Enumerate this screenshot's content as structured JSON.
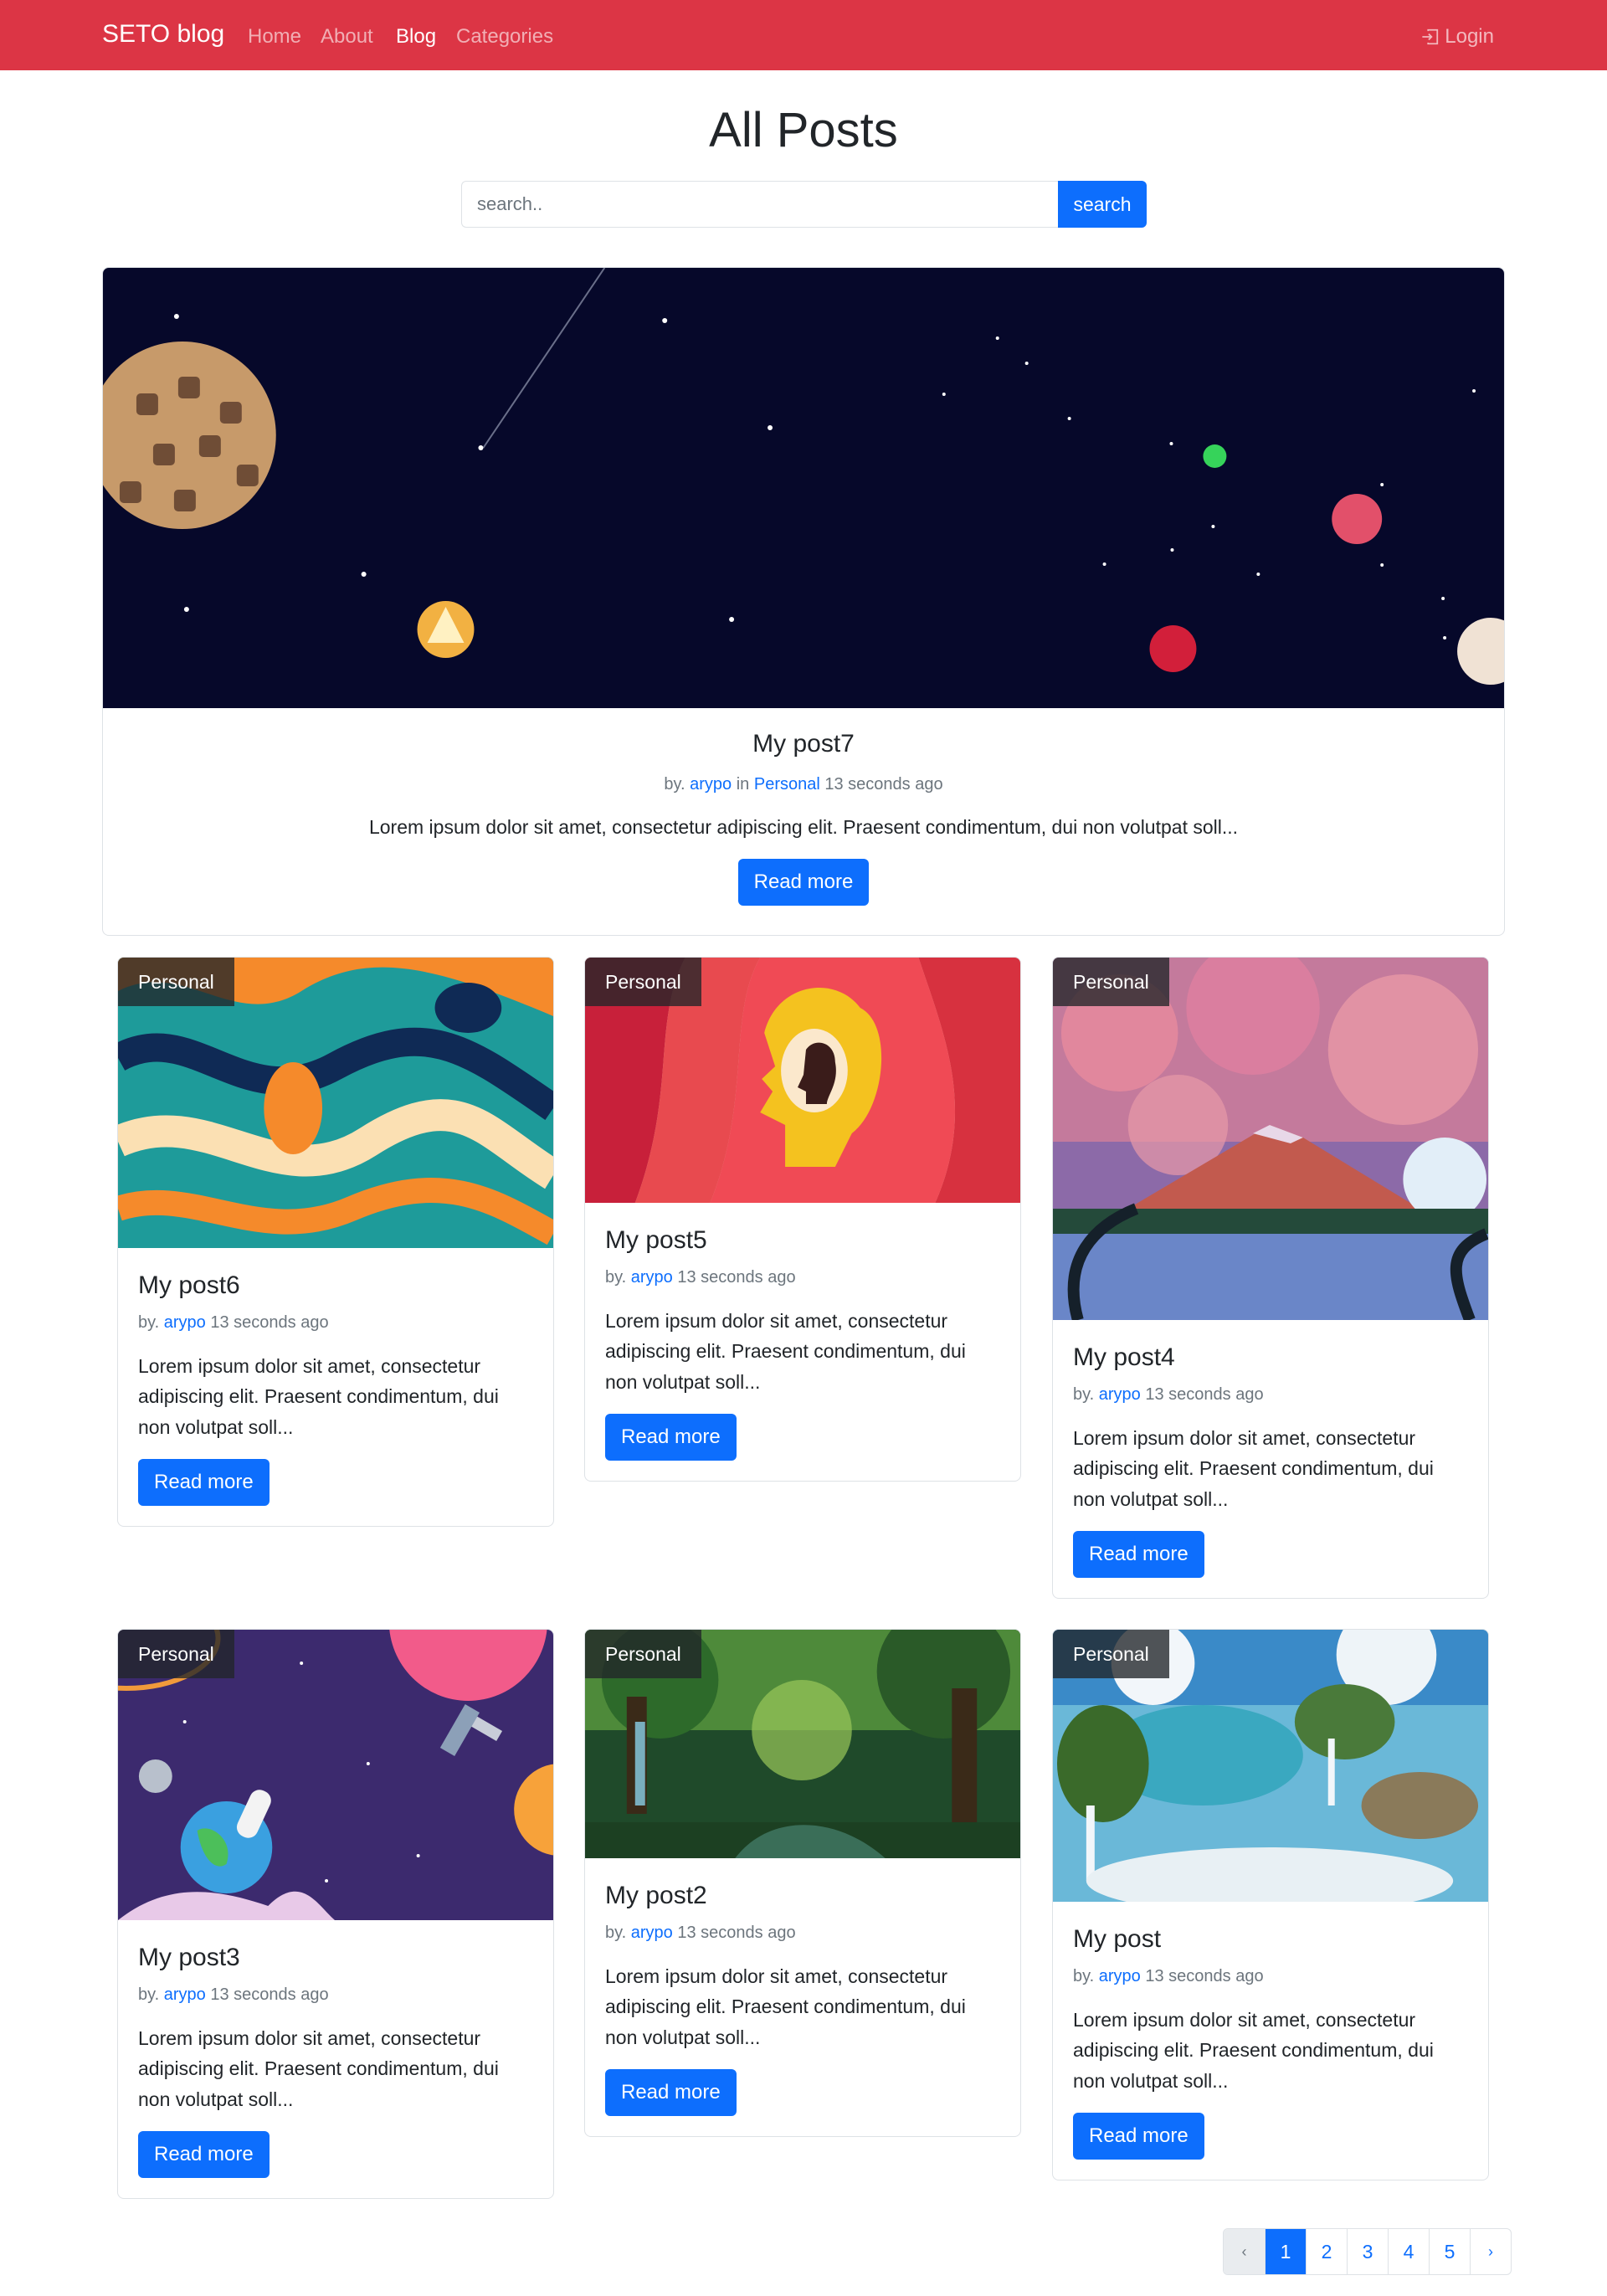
{
  "navbar": {
    "brand": "SETO blog",
    "links": [
      "Home",
      "About",
      "Blog",
      "Categories"
    ],
    "active_link": "Blog",
    "login": "Login",
    "color": "#dc3545"
  },
  "header": {
    "title": "All Posts",
    "search_placeholder": "search..",
    "search_button": "search"
  },
  "featured": {
    "title": "My post7",
    "by": "by.",
    "author": "arypo",
    "in": "in",
    "category": "Personal",
    "time": "13 seconds ago",
    "excerpt": "Lorem ipsum dolor sit amet, consectetur adipiscing elit. Praesent condimentum, dui non volutpat soll...",
    "button": "Read more"
  },
  "posts": [
    {
      "badge": "Personal",
      "title": "My post6",
      "by": "by.",
      "author": "arypo",
      "time": "13 seconds ago",
      "excerpt": "Lorem ipsum dolor sit amet, consectetur adipiscing elit. Praesent condimentum, dui non volutpat soll...",
      "button": "Read more"
    },
    {
      "badge": "Personal",
      "title": "My post5",
      "by": "by.",
      "author": "arypo",
      "time": "13 seconds ago",
      "excerpt": "Lorem ipsum dolor sit amet, consectetur adipiscing elit. Praesent condimentum, dui non volutpat soll...",
      "button": "Read more"
    },
    {
      "badge": "Personal",
      "title": "My post4",
      "by": "by.",
      "author": "arypo",
      "time": "13 seconds ago",
      "excerpt": "Lorem ipsum dolor sit amet, consectetur adipiscing elit. Praesent condimentum, dui non volutpat soll...",
      "button": "Read more"
    },
    {
      "badge": "Personal",
      "title": "My post3",
      "by": "by.",
      "author": "arypo",
      "time": "13 seconds ago",
      "excerpt": "Lorem ipsum dolor sit amet, consectetur adipiscing elit. Praesent condimentum, dui non volutpat soll...",
      "button": "Read more"
    },
    {
      "badge": "Personal",
      "title": "My post2",
      "by": "by.",
      "author": "arypo",
      "time": "13 seconds ago",
      "excerpt": "Lorem ipsum dolor sit amet, consectetur adipiscing elit. Praesent condimentum, dui non volutpat soll...",
      "button": "Read more"
    },
    {
      "badge": "Personal",
      "title": "My post",
      "by": "by.",
      "author": "arypo",
      "time": "13 seconds ago",
      "excerpt": "Lorem ipsum dolor sit amet, consectetur adipiscing elit. Praesent condimentum, dui non volutpat soll...",
      "button": "Read more"
    }
  ],
  "pagination": {
    "prev": "‹",
    "pages": [
      "1",
      "2",
      "3",
      "4",
      "5"
    ],
    "active": "1",
    "next": "›"
  }
}
